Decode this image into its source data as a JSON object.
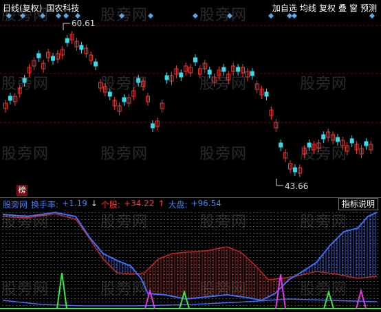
{
  "header": {
    "period_label": "日线(复权)",
    "stock_name": "国农科技"
  },
  "toolbar": {
    "add_watchlist": "加自选",
    "ma_line": "均线",
    "adjust": "复权",
    "overlay": "叠",
    "window": "窗",
    "forecast": "预测"
  },
  "price_labels": {
    "high": "60.61",
    "low": "43.66"
  },
  "rank_badge": "榜",
  "indicator": {
    "name": "股旁网",
    "turnover_label": "换手率:",
    "turnover_value": "+1.19",
    "turnover_arrow": "↓",
    "stock_label": "个股:",
    "stock_value": "+34.22",
    "stock_arrow": "↑",
    "market_label": "大盘:",
    "market_value": "+96.54",
    "help_button": "指标说明"
  },
  "watermark": "股旁网",
  "colors": {
    "up": "#ff3333",
    "down": "#33ddee",
    "blue_line": "#3b6fff",
    "red_line": "#cc2222",
    "green_spike": "#33ee33",
    "magenta_spike": "#ee33ee",
    "dotted": "#dddddd"
  }
}
